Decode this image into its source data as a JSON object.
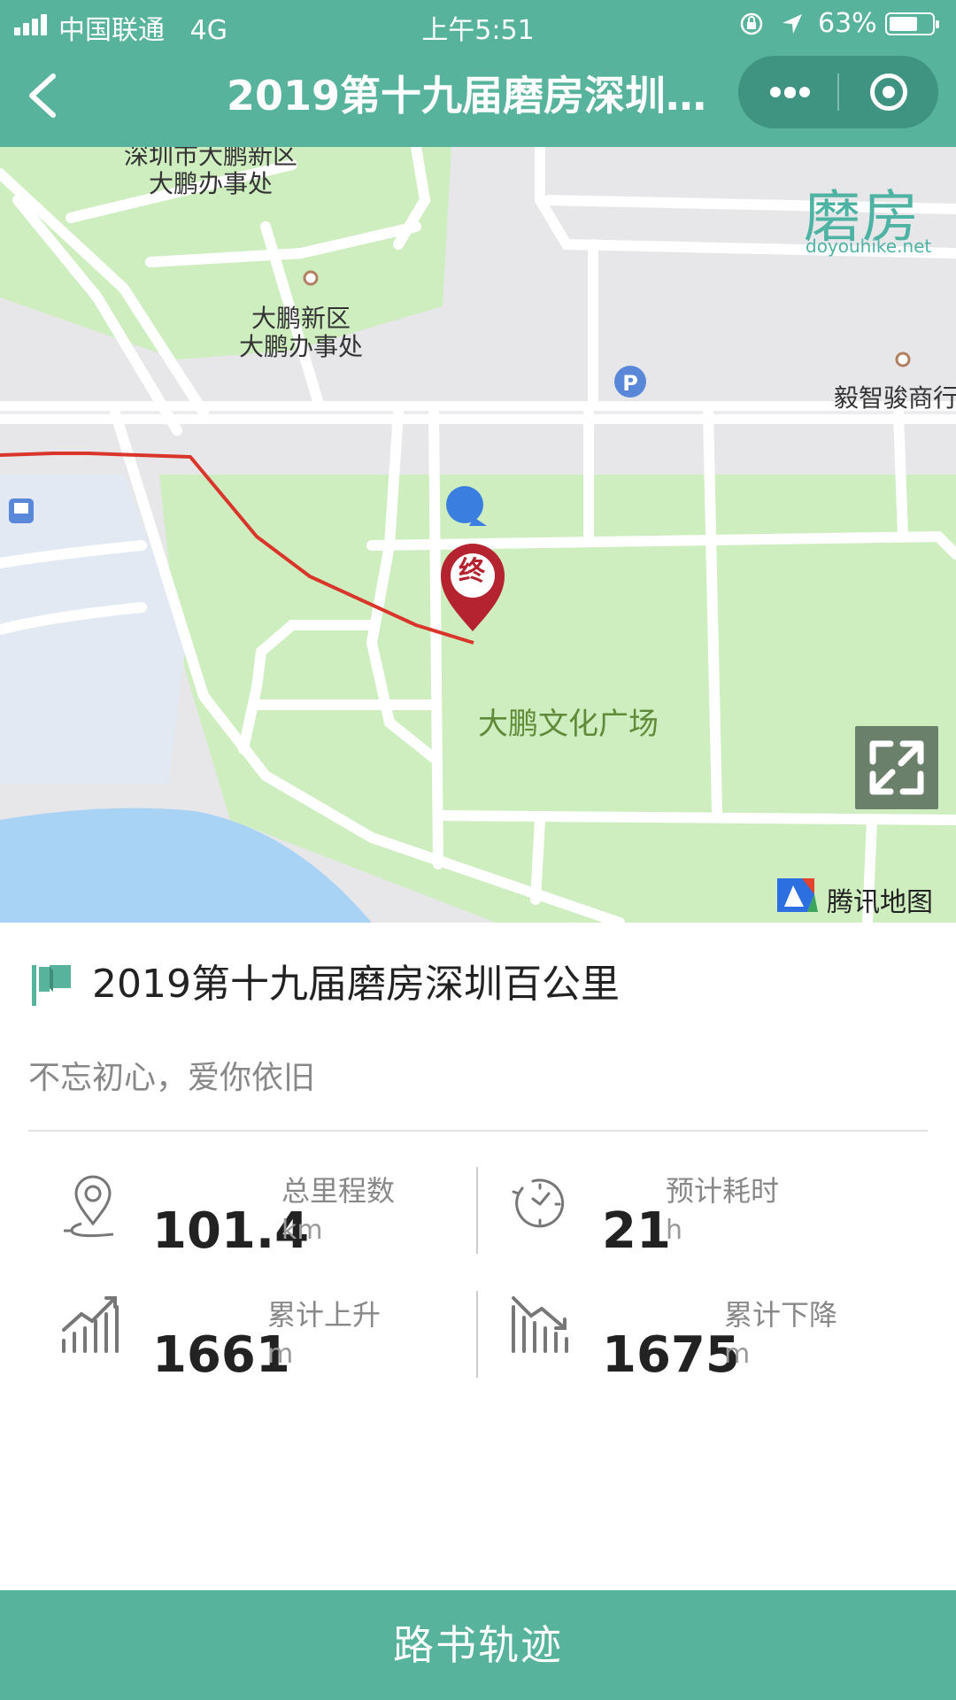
{
  "status_bar": {
    "carrier": "中国联通",
    "network": "4G",
    "time": "上午5:51",
    "battery": "63%",
    "battery_level": 0.63
  },
  "nav": {
    "title": "2019第十九届磨房深圳…",
    "icons": [
      "back-chevron-icon",
      "more-dots-icon",
      "close-target-icon"
    ]
  },
  "map": {
    "brand_cn": "磨房",
    "brand_en": "doyouhike.net",
    "labels": {
      "office_top": "深圳市大鹏新区\n大鹏办事处",
      "office_mid": "大鹏新区\n大鹏办事处",
      "company": "毅智骏商行",
      "plaza": "大鹏文化广场"
    },
    "end_marker": "终",
    "attribution": "腾讯地图",
    "colors": {
      "route": "#d9352a",
      "green": "#cfeec0",
      "water": "#a9d3f5",
      "marker": "#b52230"
    }
  },
  "route": {
    "title": "2019第十九届磨房深圳百公里",
    "slogan": "不忘初心，爱你依旧"
  },
  "stats": {
    "distance": {
      "label": "总里程数",
      "value": "101.4",
      "unit": "km"
    },
    "duration": {
      "label": "预计耗时",
      "value": "21",
      "unit": "h"
    },
    "ascent": {
      "label": "累计上升",
      "value": "1661",
      "unit": "m"
    },
    "descent": {
      "label": "累计下降",
      "value": "1675",
      "unit": "m"
    }
  },
  "bottom_button": "路书轨迹",
  "accent": "#58b39c"
}
